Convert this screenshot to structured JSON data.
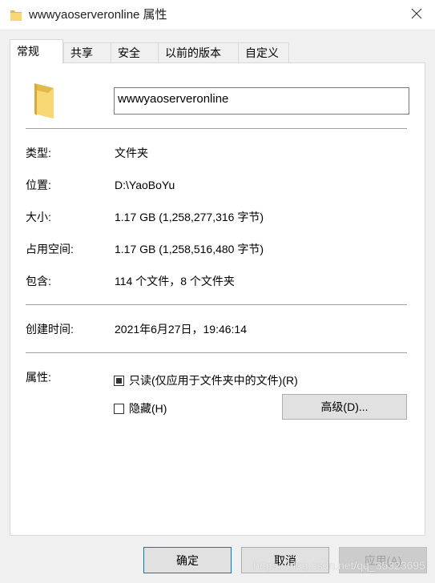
{
  "window": {
    "title": "wwwyaoserveronline 属性",
    "close_icon": "close-icon"
  },
  "tabs": [
    {
      "label": "常规",
      "active": true
    },
    {
      "label": "共享",
      "active": false
    },
    {
      "label": "安全",
      "active": false
    },
    {
      "label": "以前的版本",
      "active": false
    },
    {
      "label": "自定义",
      "active": false
    }
  ],
  "general": {
    "folder_icon": "folder-icon",
    "name_value": "wwwyaoserveronline",
    "type_label": "类型:",
    "type_value": "文件夹",
    "location_label": "位置:",
    "location_value": "D:\\YaoBoYu",
    "size_label": "大小:",
    "size_value": "1.17 GB (1,258,277,316 字节)",
    "size_on_disk_label": "占用空间:",
    "size_on_disk_value": "1.17 GB (1,258,516,480 字节)",
    "contains_label": "包含:",
    "contains_value": "114 个文件，8 个文件夹",
    "created_label": "创建时间:",
    "created_value": "2021年6月27日，19:46:14",
    "attributes_label": "属性:",
    "readonly_label": "只读(仅应用于文件夹中的文件)(R)",
    "readonly_state": "indeterminate",
    "hidden_label": "隐藏(H)",
    "hidden_state": "unchecked",
    "advanced_label": "高级(D)..."
  },
  "buttons": {
    "ok_label": "确定",
    "cancel_label": "取消",
    "apply_label": "应用(A)"
  },
  "watermark": "https://blog.csdn.net/qq_35323695",
  "colors": {
    "folder_yellow": "#f8d775",
    "folder_shadow": "#e2b94b",
    "accent_blue": "#0078d7",
    "panel_white": "#ffffff",
    "dialog_gray": "#f0f0f0"
  }
}
